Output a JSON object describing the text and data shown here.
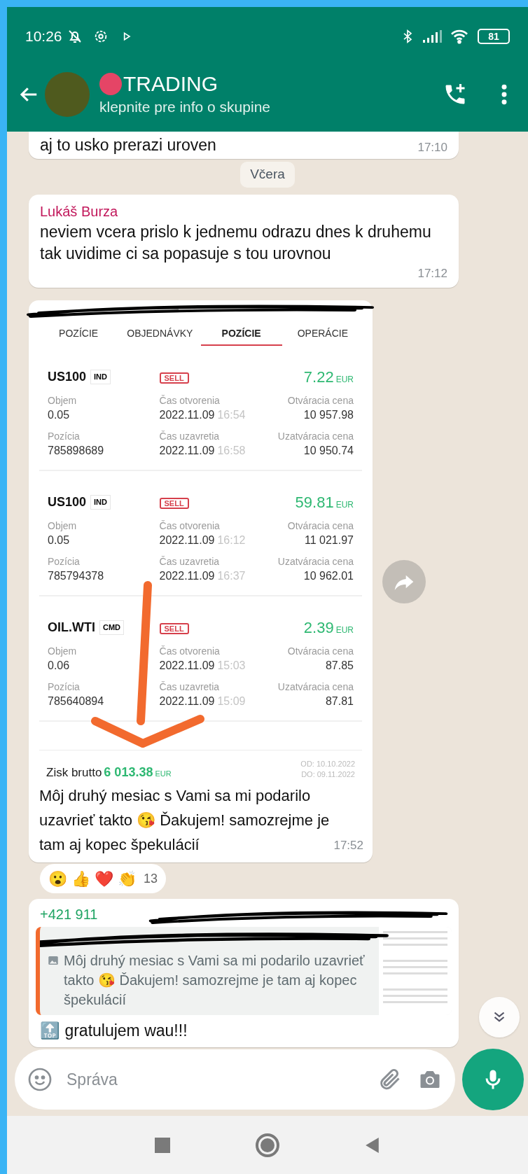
{
  "status_bar": {
    "time": "10:26",
    "battery": "81"
  },
  "header": {
    "title": "TRADING",
    "subtitle": "klepnite pre info o skupine"
  },
  "messages": [
    {
      "kind": "text",
      "text": "aj to usko prerazi uroven",
      "time": "17:10"
    },
    {
      "kind": "date",
      "text": "Včera"
    },
    {
      "kind": "text",
      "sender": "Lukáš Burza",
      "text": "neviem vcera prislo k jednemu odrazu dnes k druhemu tak uvidime ci sa popasuje s tou urovnou",
      "time": "17:12"
    },
    {
      "kind": "image",
      "screenshot": {
        "tabs": [
          {
            "label": "POZÍCIE",
            "selected": false
          },
          {
            "label": "OBJEDNÁVKY",
            "selected": false
          },
          {
            "label": "POZÍCIE",
            "selected": true
          },
          {
            "label": "OPERÁCIE",
            "selected": false
          }
        ],
        "positions": [
          {
            "symbol": "US100",
            "tag": "IND",
            "side": "SELL",
            "profit": "7.22",
            "currency": "EUR",
            "cells": [
              {
                "label": "Objem",
                "value": "0.05"
              },
              {
                "label": "Čas otvorenia",
                "value": "2022.11.09",
                "time": "16:54"
              },
              {
                "label": "Otváracia cena",
                "value": "10 957.98"
              },
              {
                "label": "Pozícia",
                "value": "785898689"
              },
              {
                "label": "Čas uzavretia",
                "value": "2022.11.09",
                "time": "16:58"
              },
              {
                "label": "Uzatváracia cena",
                "value": "10 950.74"
              }
            ]
          },
          {
            "symbol": "US100",
            "tag": "IND",
            "side": "SELL",
            "profit": "59.81",
            "currency": "EUR",
            "cells": [
              {
                "label": "Objem",
                "value": "0.05"
              },
              {
                "label": "Čas otvorenia",
                "value": "2022.11.09",
                "time": "16:12"
              },
              {
                "label": "Otváracia cena",
                "value": "11 021.97"
              },
              {
                "label": "Pozícia",
                "value": "785794378"
              },
              {
                "label": "Čas uzavretia",
                "value": "2022.11.09",
                "time": "16:37"
              },
              {
                "label": "Uzatváracia cena",
                "value": "10 962.01"
              }
            ]
          },
          {
            "symbol": "OIL.WTI",
            "tag": "CMD",
            "side": "SELL",
            "profit": "2.39",
            "currency": "EUR",
            "cells": [
              {
                "label": "Objem",
                "value": "0.06"
              },
              {
                "label": "Čas otvorenia",
                "value": "2022.11.09",
                "time": "15:03"
              },
              {
                "label": "Otváracia cena",
                "value": "87.85"
              },
              {
                "label": "Pozícia",
                "value": "785640894"
              },
              {
                "label": "Čas uzavretia",
                "value": "2022.11.09",
                "time": "15:09"
              },
              {
                "label": "Uzatváracia cena",
                "value": "87.81"
              }
            ]
          }
        ],
        "summary": {
          "label": "Zisk brutto",
          "amount": "6 013.38",
          "currency": "EUR",
          "period": [
            "OD: 10.10.2022",
            "DO: 09.11.2022"
          ]
        }
      },
      "caption": "Môj druhý mesiac s Vami sa mi podarilo uzavrieť takto 😘 Ďakujem! samozrejme je tam aj kopec špekulácií",
      "time": "17:52",
      "reactions": {
        "emojis": [
          "😮",
          "👍",
          "❤️",
          "👏"
        ],
        "count": "13"
      }
    },
    {
      "kind": "reply",
      "sender": "+421 911",
      "quote": "Môj druhý mesiac s Vami sa mi podarilo uzavrieť takto 😘 Ďakujem! samozrejme je tam aj kopec špekulácií",
      "text": "🔝 gratulujem wau!!!"
    }
  ],
  "composer": {
    "placeholder": "Správa"
  }
}
